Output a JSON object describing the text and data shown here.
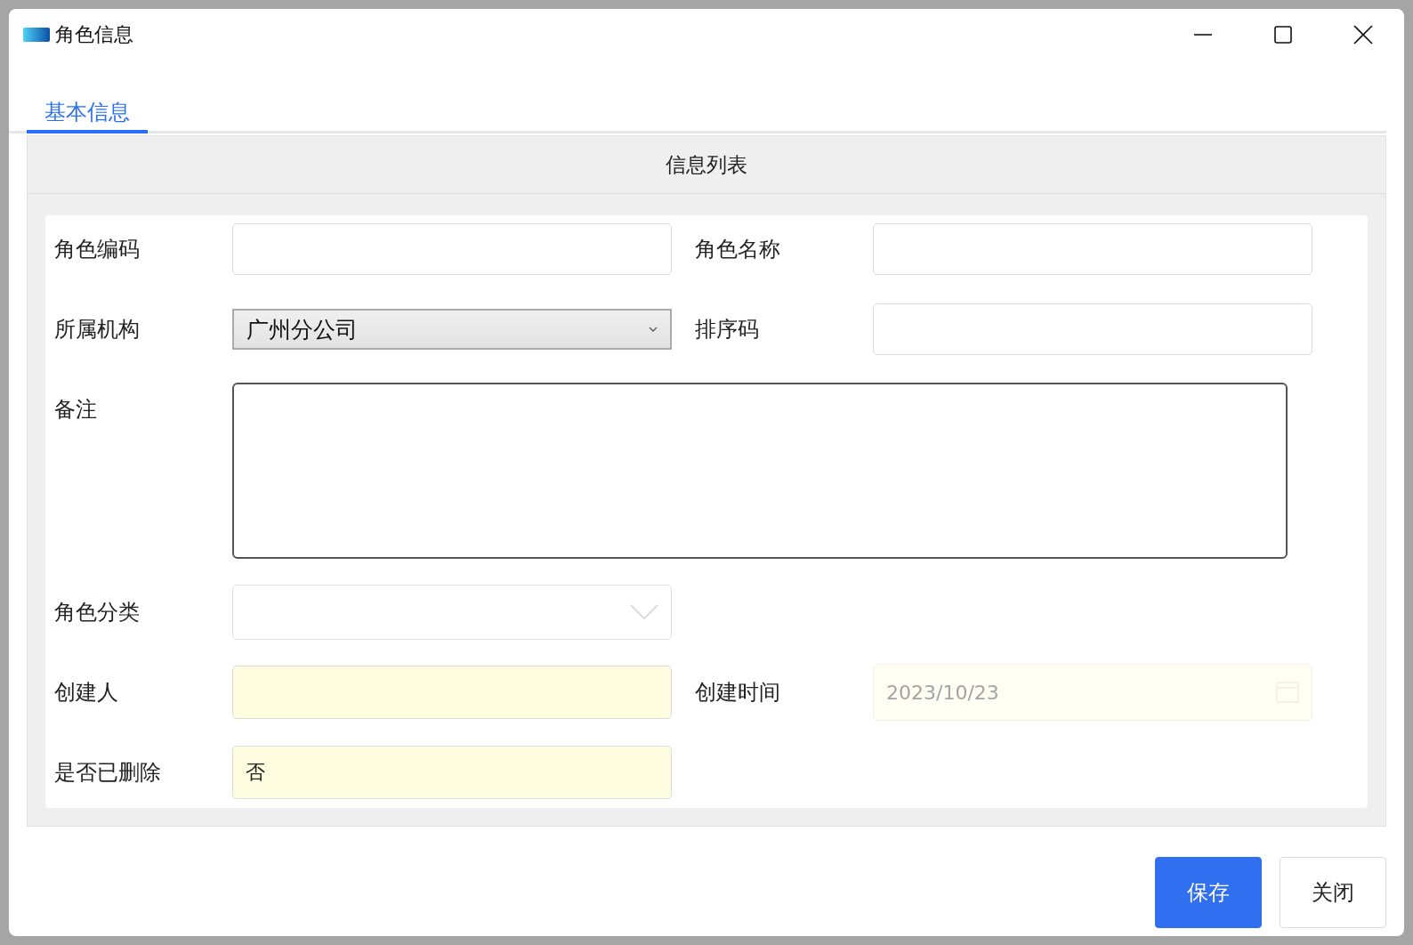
{
  "window": {
    "title": "角色信息"
  },
  "tabs": [
    {
      "label": "基本信息",
      "selected": true
    }
  ],
  "panel": {
    "title": "信息列表"
  },
  "rows": [
    [
      {
        "label": "角色编码",
        "kind": "text"
      },
      {
        "label": "角色名称",
        "kind": "text"
      }
    ],
    [
      {
        "label": "所属机构",
        "kind": "select",
        "value": "广州分公司"
      },
      {
        "label": "排序码",
        "kind": "text"
      }
    ],
    [
      {
        "label": "备注",
        "kind": "textarea"
      }
    ],
    [
      {
        "label": "角色分类",
        "kind": "dropdown"
      }
    ],
    [
      {
        "label": "创建人",
        "kind": "readonly"
      },
      {
        "label": "创建时间",
        "kind": "date",
        "value": "2023/10/23"
      }
    ],
    [
      {
        "label": "是否已删除",
        "kind": "readonly",
        "value": "否"
      }
    ]
  ],
  "buttons": [
    {
      "label": "保存",
      "primary": true
    },
    {
      "label": "关闭",
      "primary": false
    }
  ]
}
